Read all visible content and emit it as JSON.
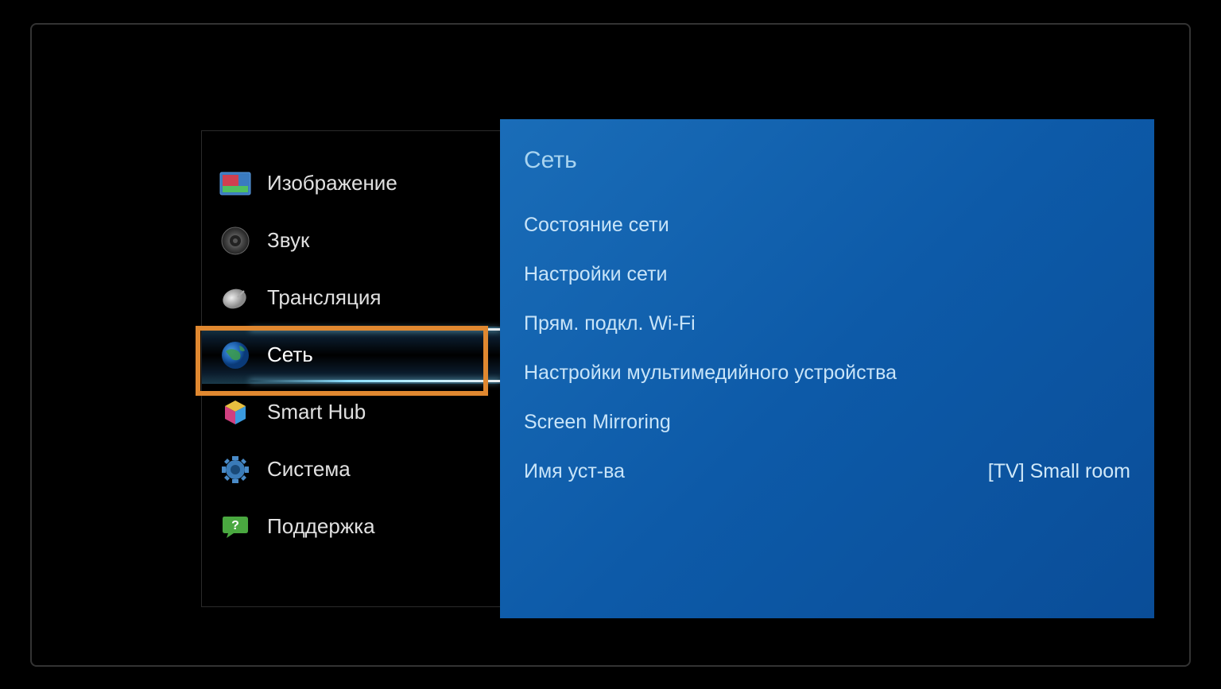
{
  "sidebar": {
    "items": [
      {
        "label": "Изображение",
        "icon": "picture"
      },
      {
        "label": "Звук",
        "icon": "sound"
      },
      {
        "label": "Трансляция",
        "icon": "broadcast"
      },
      {
        "label": "Сеть",
        "icon": "network",
        "selected": true
      },
      {
        "label": "Smart Hub",
        "icon": "smarthub"
      },
      {
        "label": "Система",
        "icon": "system"
      },
      {
        "label": "Поддержка",
        "icon": "support"
      }
    ]
  },
  "detail": {
    "title": "Сеть",
    "items": [
      {
        "label": "Состояние сети"
      },
      {
        "label": "Настройки сети"
      },
      {
        "label": "Прям. подкл. Wi-Fi"
      },
      {
        "label": "Настройки мультимедийного устройства"
      },
      {
        "label": "Screen Mirroring"
      },
      {
        "label": "Имя уст-ва",
        "value": "[TV] Small room"
      }
    ]
  }
}
